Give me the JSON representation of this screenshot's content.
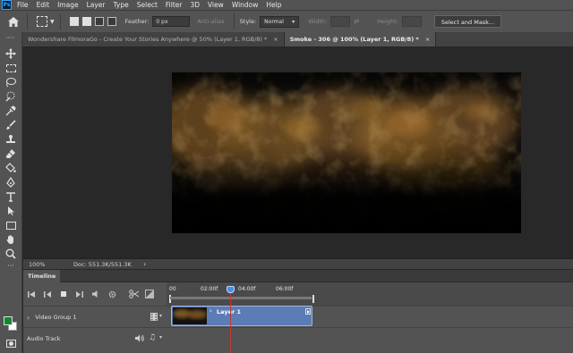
{
  "app": {
    "logo": "Ps"
  },
  "menu": [
    "File",
    "Edit",
    "Image",
    "Layer",
    "Type",
    "Select",
    "Filter",
    "3D",
    "View",
    "Window",
    "Help"
  ],
  "options": {
    "feather_label": "Feather:",
    "feather_value": "0 px",
    "antialias_label": "Anti-alias",
    "style_label": "Style:",
    "style_value": "Normal",
    "width_label": "Width:",
    "height_label": "Height:",
    "select_mask_label": "Select and Mask..."
  },
  "tabs": [
    {
      "label": "Wondershare FilmoraGo - Create Your Stories Anywhere @ 50% (Layer 1, RGB/8) *",
      "close": "×",
      "active": false
    },
    {
      "label": "Smoke - 306 @ 100% (Layer 1, RGB/8) *",
      "close": "×",
      "active": true
    }
  ],
  "status": {
    "zoom": "100%",
    "doc": "Doc: 551.3K/551.3K",
    "arrow": "›"
  },
  "timeline": {
    "tab_label": "Timeline",
    "ticks": [
      "00",
      "02:00f",
      "04:00f",
      "06:00f"
    ],
    "tracks": [
      {
        "label": "Video Group 1",
        "arrow": "›"
      },
      {
        "label": "Audio Track"
      }
    ],
    "clip_label": "Layer 1",
    "clip_arrow": "›"
  },
  "colors": {
    "foreground": "#0e8c2d",
    "background": "#ffffff",
    "clip": "#5b7cb5",
    "playhead": "#c03a3a"
  }
}
